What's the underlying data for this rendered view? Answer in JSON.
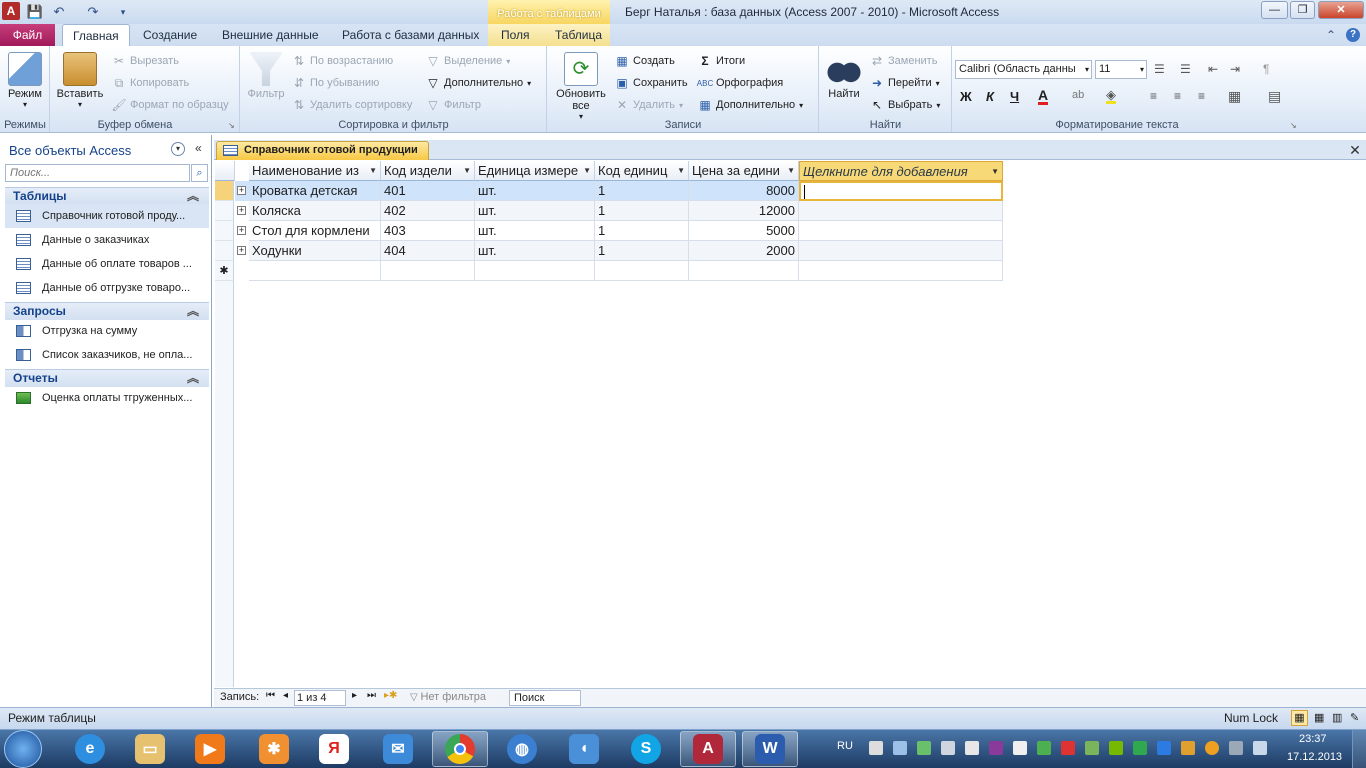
{
  "window": {
    "title": "Берг Наталья : база данных (Access 2007 - 2010)  -  Microsoft Access",
    "context_tab_group": "Работа с таблицами",
    "controls": {
      "minimize": "—",
      "restore": "❐",
      "close": "✕"
    }
  },
  "ribbon_tabs": {
    "file": "Файл",
    "items": [
      "Главная",
      "Создание",
      "Внешние данные",
      "Работа с базами данных",
      "Поля",
      "Таблица"
    ],
    "active": "Главная"
  },
  "ribbon": {
    "groups": {
      "views": {
        "label": "Режимы",
        "mode": "Режим"
      },
      "clipboard": {
        "label": "Буфер обмена",
        "paste": "Вставить",
        "cut": "Вырезать",
        "copy": "Копировать",
        "format_painter": "Формат по образцу"
      },
      "sort_filter": {
        "label": "Сортировка и фильтр",
        "filter": "Фильтр",
        "ascending": "По возрастанию",
        "descending": "По убыванию",
        "remove_sort": "Удалить сортировку",
        "selection": "Выделение",
        "advanced": "Дополнительно",
        "toggle_filter": "Фильтр"
      },
      "records": {
        "label": "Записи",
        "refresh": "Обновить все",
        "new": "Создать",
        "save": "Сохранить",
        "delete": "Удалить",
        "totals": "Итоги",
        "spelling": "Орфография",
        "more": "Дополнительно"
      },
      "find": {
        "label": "Найти",
        "find": "Найти",
        "replace": "Заменить",
        "goto": "Перейти",
        "select": "Выбрать"
      },
      "text_format": {
        "label": "Форматирование текста",
        "font": "Calibri (Область данны",
        "size": "11",
        "bold": "Ж",
        "italic": "К",
        "underline": "Ч"
      }
    }
  },
  "nav_pane": {
    "title": "Все объекты Access",
    "search_placeholder": "Поиск...",
    "sections": [
      {
        "title": "Таблицы",
        "items": [
          "Справочник готовой проду...",
          "Данные о заказчиках",
          "Данные об оплате товаров ...",
          "Данные об отгрузке товаро..."
        ]
      },
      {
        "title": "Запросы",
        "items": [
          "Отгрузка на сумму",
          "Список заказчиков, не опла..."
        ]
      },
      {
        "title": "Отчеты",
        "items": [
          "Оценка оплаты тгруженных..."
        ]
      }
    ]
  },
  "document": {
    "tab_title": "Справочник готовой продукции",
    "close": "✕",
    "columns": [
      "Наименование из",
      "Код издели",
      "Единица измере",
      "Код единиц",
      "Цена за едини",
      "Щелкните для добавления"
    ],
    "rows": [
      [
        "Кроватка детская",
        "401",
        "шт.",
        "1",
        "8000"
      ],
      [
        "Коляска",
        "402",
        "шт.",
        "1",
        "12000"
      ],
      [
        "Стол для кормлени",
        "403",
        "шт.",
        "1",
        "5000"
      ],
      [
        "Ходунки",
        "404",
        "шт.",
        "1",
        "2000"
      ]
    ],
    "new_row_marker": "✱"
  },
  "record_nav": {
    "label": "Запись:",
    "position": "1 из 4",
    "filter": "Нет фильтра",
    "search": "Поиск"
  },
  "status_bar": {
    "mode": "Режим таблицы",
    "numlock": "Num Lock"
  },
  "taskbar": {
    "language": "RU",
    "time": "23:37",
    "date": "17.12.2013",
    "apps": [
      "windows-start",
      "internet-explorer",
      "explorer",
      "media-player",
      "app-orange",
      "yandex",
      "mail",
      "chrome",
      "network",
      "sound",
      "skype",
      "access",
      "word"
    ],
    "active_apps": [
      "access",
      "word"
    ],
    "colors": {
      "file_tab": "#b62a6b",
      "context_tab": "#f7d560",
      "selected_row": "#cfe3fb",
      "taskbar": "#2b5384"
    }
  }
}
